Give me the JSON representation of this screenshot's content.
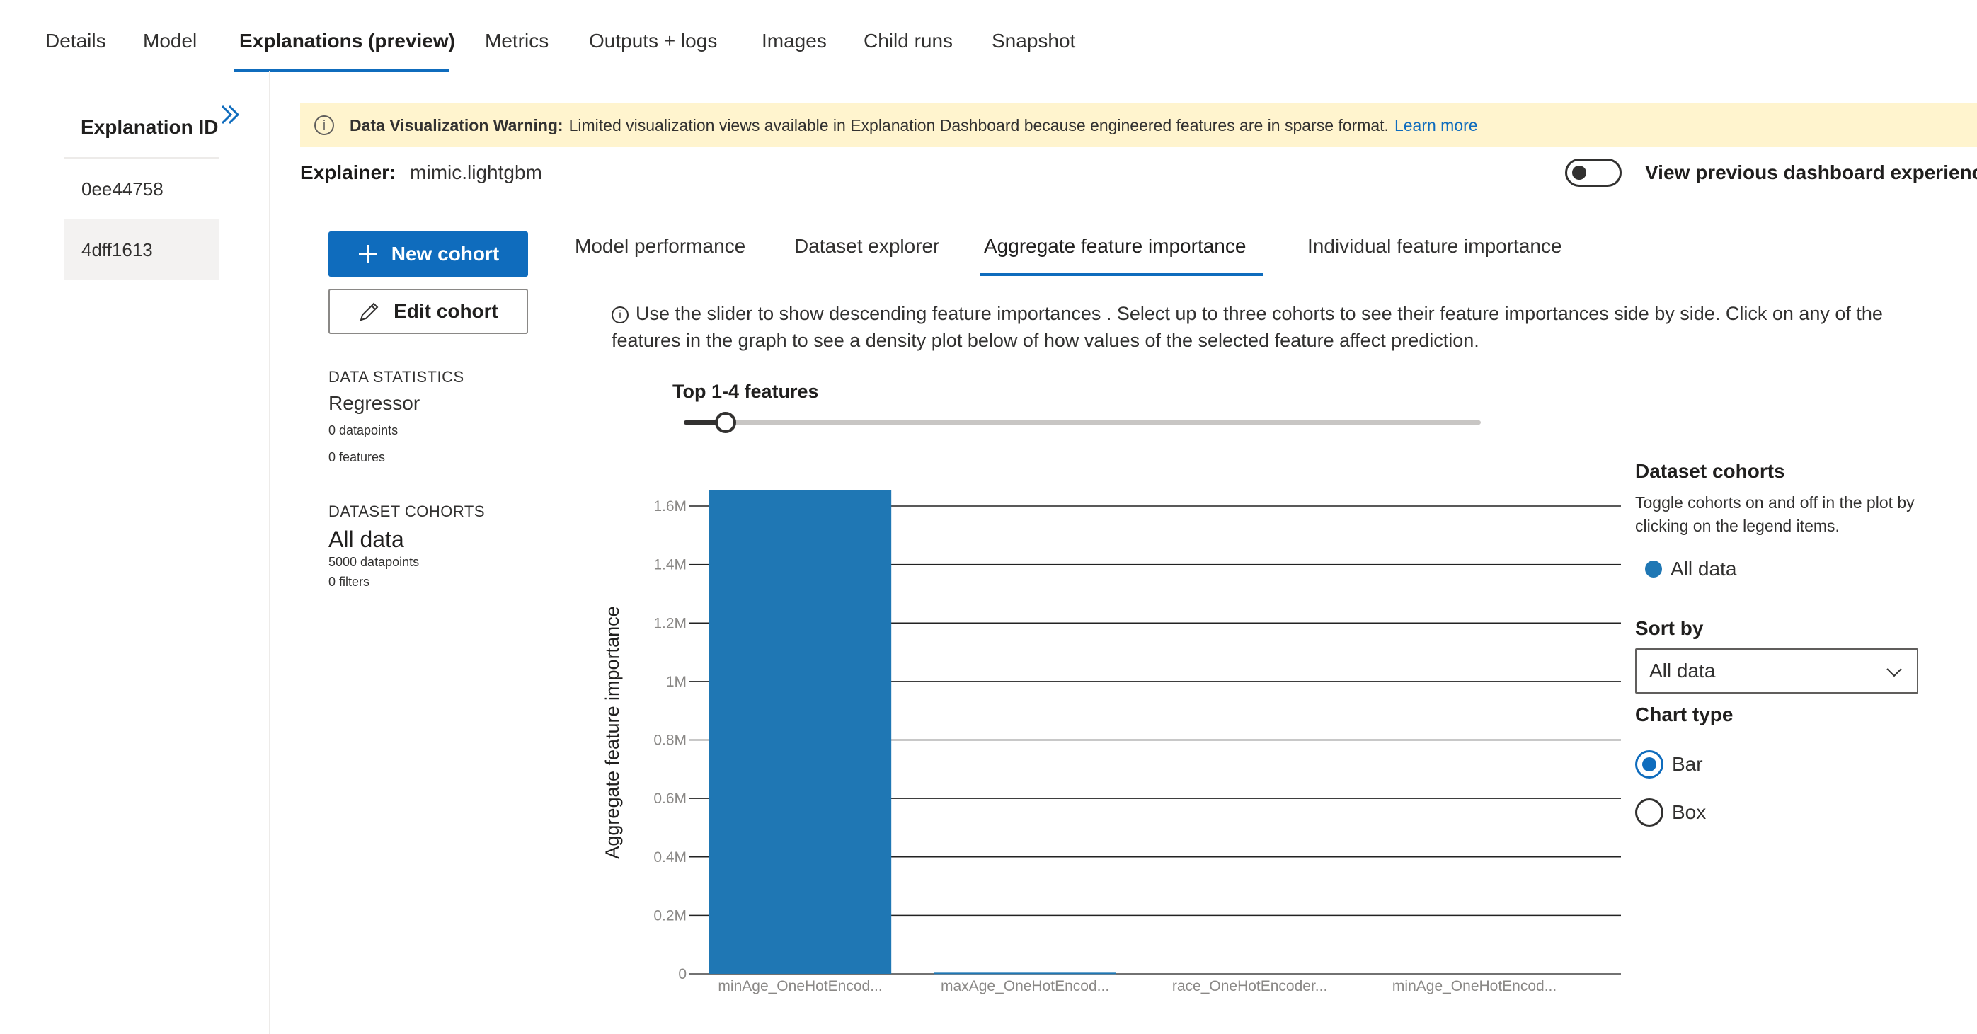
{
  "top_tabs": [
    {
      "label": "Details"
    },
    {
      "label": "Model"
    },
    {
      "label": "Explanations (preview)",
      "active": true
    },
    {
      "label": "Metrics"
    },
    {
      "label": "Outputs + logs"
    },
    {
      "label": "Images"
    },
    {
      "label": "Child runs"
    },
    {
      "label": "Snapshot"
    }
  ],
  "explanations": {
    "header": "Explanation ID",
    "collapse_icon": "double-chevron-right-icon",
    "items": [
      {
        "label": "0ee44758"
      },
      {
        "label": "4dff1613",
        "selected": true
      }
    ]
  },
  "banner": {
    "icon": "info-icon",
    "title": "Data Visualization Warning:",
    "message": "Limited visualization views available in Explanation Dashboard because engineered features are in sparse format.",
    "link": "Learn more",
    "background": "#fff4ce"
  },
  "explainer": {
    "label": "Explainer:",
    "value": "mimic.lightgbm"
  },
  "toggle": {
    "label": "View previous dashboard experience",
    "on": false
  },
  "cohort_buttons": {
    "new_cohort": "New cohort",
    "edit_cohort": "Edit cohort"
  },
  "data_statistics": {
    "heading": "DATA STATISTICS",
    "model_type": "Regressor",
    "datapoints": "0 datapoints",
    "features": "0 features"
  },
  "dataset_cohorts_summary": {
    "heading": "DATASET COHORTS",
    "name": "All data",
    "datapoints": "5000 datapoints",
    "filters": "0 filters"
  },
  "dashboard_tabs": [
    {
      "label": "Model performance"
    },
    {
      "label": "Dataset explorer"
    },
    {
      "label": "Aggregate feature importance",
      "active": true
    },
    {
      "label": "Individual feature importance"
    }
  ],
  "description": "Use the slider to show descending feature importances . Select up to three cohorts to see their feature importances side by side. Click on any of the features in the graph to see a density plot below of how values of the selected feature affect prediction.",
  "slider": {
    "label": "Top 1-4 features",
    "value_fraction": 0.05
  },
  "legend_panel": {
    "title": "Dataset cohorts",
    "instructions": "Toggle cohorts on and off in the plot by clicking on the legend items.",
    "cohorts": [
      {
        "label": "All data",
        "color": "#1f77b4"
      }
    ],
    "sort_by_label": "Sort by",
    "sort_by_value": "All data",
    "chart_type_label": "Chart type",
    "chart_types": [
      {
        "label": "Bar",
        "checked": true
      },
      {
        "label": "Box",
        "checked": false
      }
    ]
  },
  "chart_data": {
    "type": "bar",
    "ylabel": "Aggregate feature importance",
    "xlabel": "",
    "categories": [
      "minAge_OneHotEncod...",
      "maxAge_OneHotEncod...",
      "race_OneHotEncoder...",
      "minAge_OneHotEncod..."
    ],
    "series": [
      {
        "name": "All data",
        "values": [
          1655000,
          4000,
          0,
          0
        ],
        "color": "#1f77b4"
      }
    ],
    "ylim": [
      0,
      1600000
    ],
    "yticks": [
      0,
      200000,
      400000,
      600000,
      800000,
      1000000,
      1200000,
      1400000,
      1600000
    ],
    "ytick_labels": [
      "0",
      "0.2M",
      "0.4M",
      "0.6M",
      "0.8M",
      "1M",
      "1.2M",
      "1.4M",
      "1.6M"
    ],
    "grid": true
  }
}
